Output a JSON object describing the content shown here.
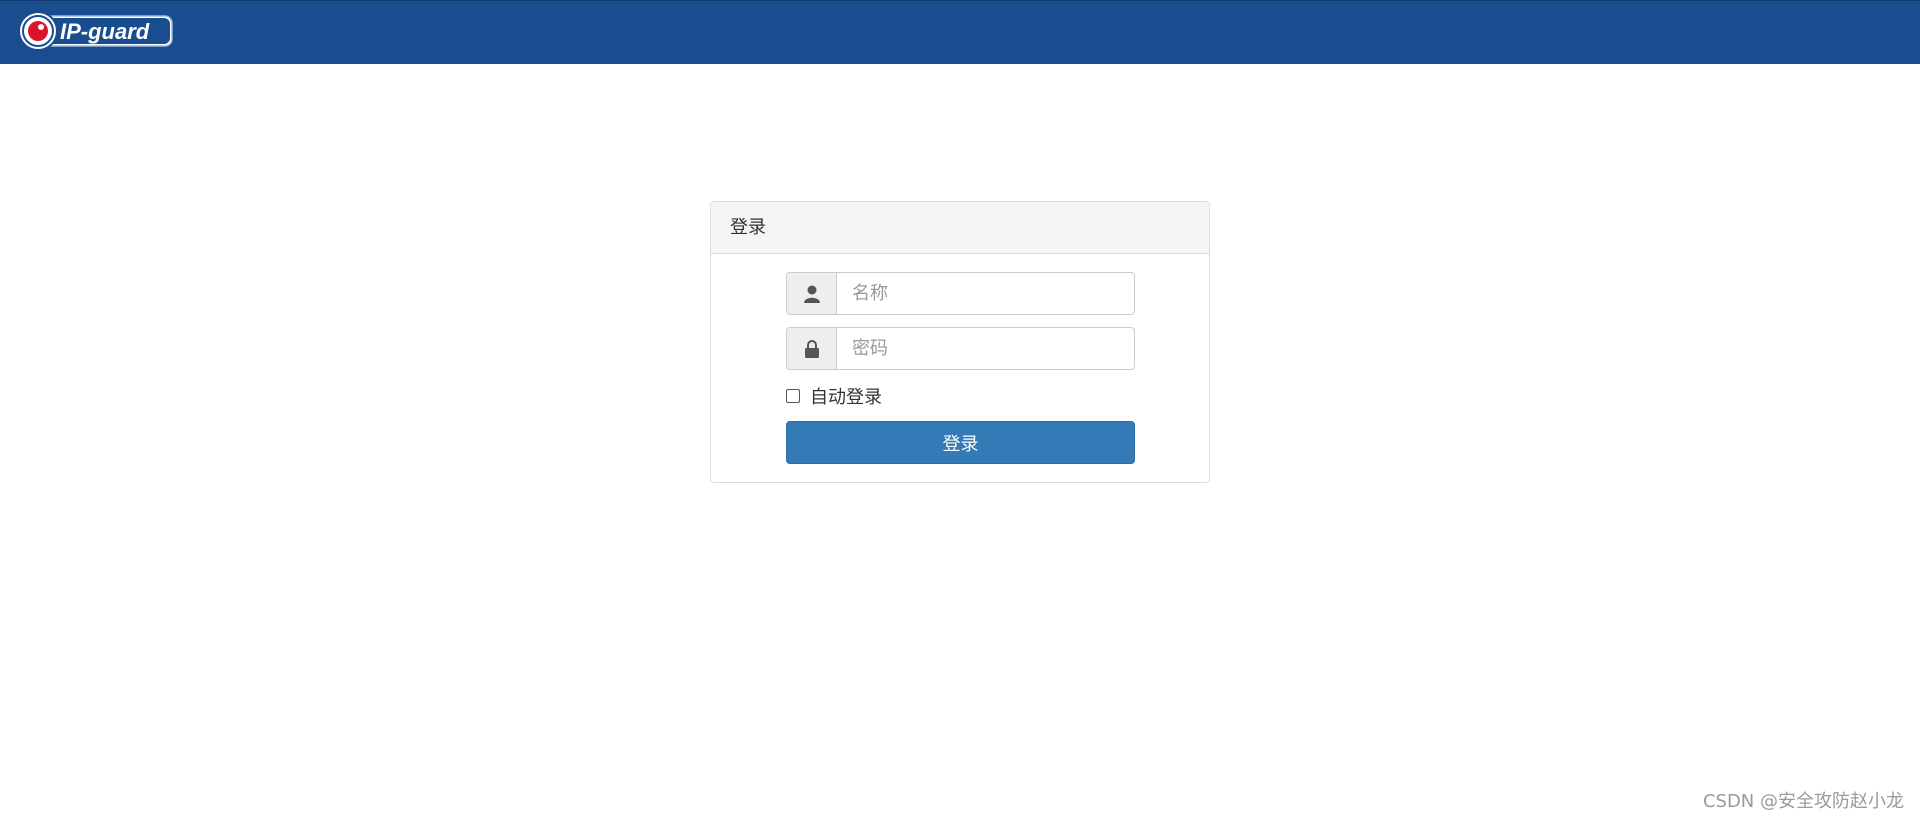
{
  "header": {
    "logo_text": "IP-guard",
    "logo_icon": "eye-logo-icon",
    "background_color": "#1a4d8f"
  },
  "login_panel": {
    "title": "登录",
    "username": {
      "placeholder": "名称",
      "value": "",
      "icon": "user-icon"
    },
    "password": {
      "placeholder": "密码",
      "value": "",
      "icon": "lock-icon"
    },
    "remember": {
      "label": "自动登录",
      "checked": false
    },
    "submit_label": "登录",
    "accent_color": "#337ab7"
  },
  "watermark": "CSDN @安全攻防赵小龙"
}
